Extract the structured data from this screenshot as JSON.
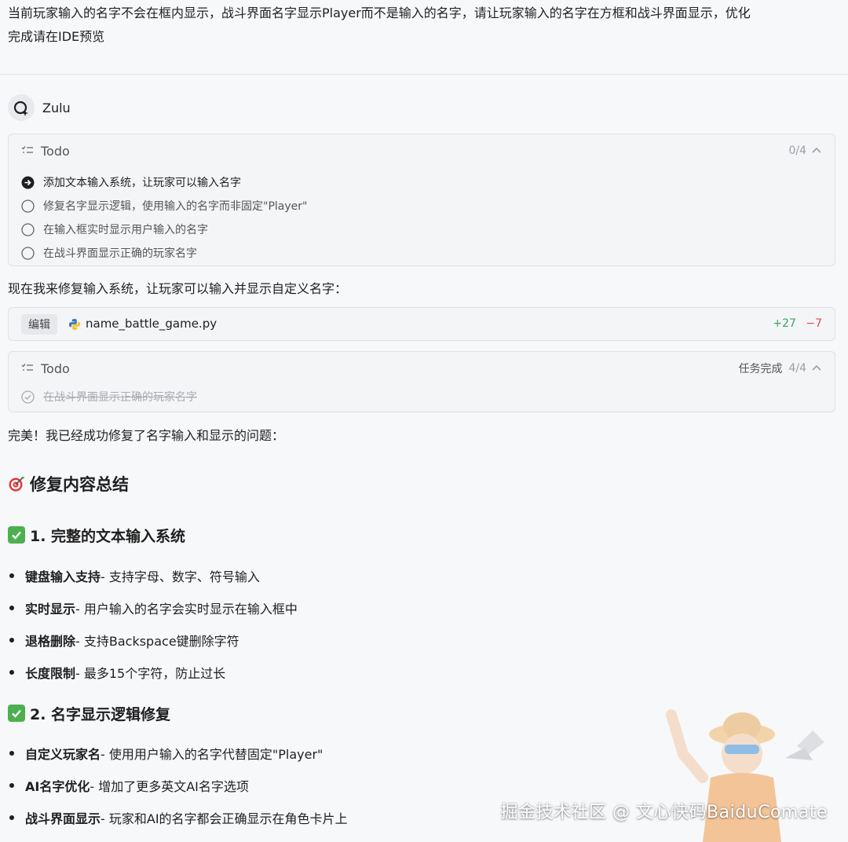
{
  "prompt": {
    "line1": "当前玩家输入的名字不会在框内显示，战斗界面名字显示Player而不是输入的名字，请让玩家输入的名字在方框和战斗界面显示，优化",
    "line2": "完成请在IDE预览"
  },
  "agent": {
    "name": "Zulu"
  },
  "todo1": {
    "title": "Todo",
    "progress": "0/4",
    "items": [
      {
        "label": "添加文本输入系统，让玩家可以输入名字",
        "state": "active"
      },
      {
        "label": "修复名字显示逻辑，使用输入的名字而非固定\"Player\"",
        "state": "pending"
      },
      {
        "label": "在输入框实时显示用户输入的名字",
        "state": "pending"
      },
      {
        "label": "在战斗界面显示正确的玩家名字",
        "state": "pending"
      }
    ]
  },
  "message1": "现在我来修复输入系统，让玩家可以输入并显示自定义名字：",
  "edit": {
    "badge": "编辑",
    "file": "name_battle_game.py",
    "additions": "+27",
    "deletions": "−7"
  },
  "todo2": {
    "title": "Todo",
    "status": "任务完成",
    "progress": "4/4",
    "items": [
      {
        "label": "在战斗界面显示正确的玩家名字",
        "state": "completed"
      }
    ]
  },
  "message2": "完美！我已经成功修复了名字输入和显示的问题：",
  "summary": {
    "title": "修复内容总结",
    "sections": [
      {
        "heading": "1. 完整的文本输入系统",
        "bullets": [
          {
            "bold": "键盘输入支持",
            "rest": " - 支持字母、数字、符号输入"
          },
          {
            "bold": "实时显示",
            "rest": " - 用户输入的名字会实时显示在输入框中"
          },
          {
            "bold": "退格删除",
            "rest": " - 支持Backspace键删除字符"
          },
          {
            "bold": "长度限制",
            "rest": " - 最多15个字符，防止过长"
          }
        ]
      },
      {
        "heading": "2. 名字显示逻辑修复",
        "bullets": [
          {
            "bold": "自定义玩家名",
            "rest": " - 使用用户输入的名字代替固定\"Player\""
          },
          {
            "bold": "AI名字优化",
            "rest": " - 增加了更多英文AI名字选项"
          },
          {
            "bold": "战斗界面显示",
            "rest": " - 玩家和AI的名字都会正确显示在角色卡片上"
          }
        ]
      }
    ]
  },
  "watermark": "掘金技术社区 @ 文心快码BaiduComate",
  "colors": {
    "background": "#f7f8fa",
    "card": "#f3f5f7",
    "additions": "#3fa65a",
    "deletions": "#e5484d",
    "check": "#4caf50"
  },
  "icons": {
    "todo": "list-check-icon",
    "collapse": "chevron-up-icon",
    "active": "arrow-circle-icon",
    "pending": "circle-icon",
    "completed": "check-circle-icon",
    "file": "python-icon",
    "agent": "zulu-logo-icon"
  }
}
